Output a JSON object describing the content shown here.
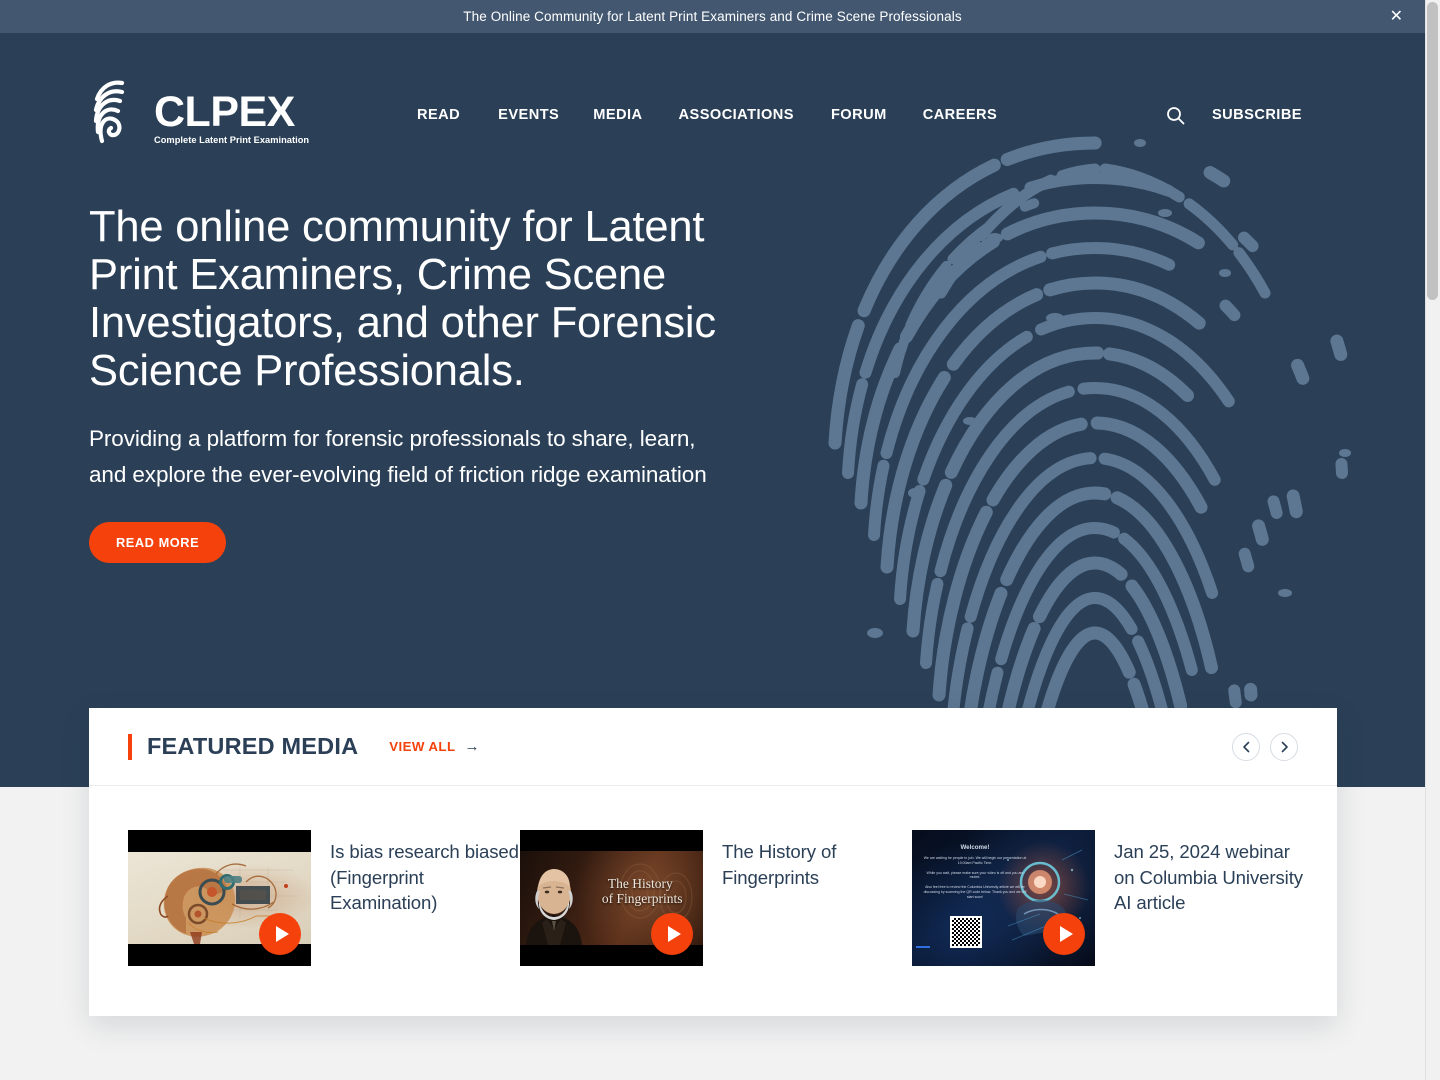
{
  "announcement": {
    "message": "The Online Community for Latent Print Examiners and Crime Scene Professionals",
    "close_label": "✕"
  },
  "brand": {
    "name": "CLPEX",
    "tagline": "Complete Latent Print Examination",
    "logo_icon": "fingerprint-icon"
  },
  "nav": {
    "items": [
      {
        "label": "READ"
      },
      {
        "label": "EVENTS"
      },
      {
        "label": "MEDIA"
      },
      {
        "label": "ASSOCIATIONS"
      },
      {
        "label": "FORUM"
      },
      {
        "label": "CAREERS"
      }
    ],
    "search_icon": "search-icon",
    "subscribe_label": "SUBSCRIBE"
  },
  "hero": {
    "title": "The online community for Latent Print Examiners, Crime Scene Investigators, and other Forensic Science Professionals.",
    "subtitle": "Providing a platform for forensic professionals to share, learn, and explore the ever-evolving field of friction ridge examination",
    "cta_label": "READ MORE",
    "background_icon": "fingerprint-watermark"
  },
  "featured_media": {
    "heading": "FEATURED MEDIA",
    "view_all_label": "VIEW ALL",
    "view_all_arrow": "→",
    "prev_icon": "chevron-left-icon",
    "next_icon": "chevron-right-icon",
    "items": [
      {
        "title": "Is bias research biased (Fingerprint Examination)",
        "thumb_kind": "mechanical-head-illustration",
        "play_icon": "play-icon"
      },
      {
        "title": "The History of Fingerprints",
        "thumb_kind": "galton-portrait",
        "thumb_overlay_line1": "The History",
        "thumb_overlay_line2": "of Fingerprints",
        "play_icon": "play-icon"
      },
      {
        "title": "Jan 25, 2024 webinar on Columbia University AI article",
        "thumb_kind": "webinar-welcome-slide",
        "slide_heading": "Welcome!",
        "slide_p1": "We are waiting for people to join. We will begin our presentation at 10:00am Pacific Time.",
        "slide_p2": "While you wait, please make sure your video is off and you are muted.",
        "slide_p3": "Also feel free to review the Columbia University article we will be discussing by scanning the QR code below. Thank you and we will start soon!",
        "play_icon": "play-icon"
      }
    ]
  },
  "colors": {
    "hero_bg": "#2b4057",
    "announcement_bg": "#435870",
    "accent_orange": "#f5420d",
    "text_navy": "#2b4057",
    "page_bg": "#f2f2f2"
  }
}
